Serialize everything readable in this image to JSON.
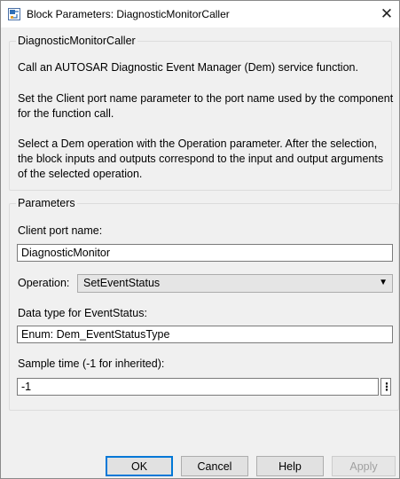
{
  "window": {
    "title": "Block Parameters: DiagnosticMonitorCaller",
    "close_symbol": "✕",
    "app_icon": "simulink-block-icon"
  },
  "description_group": {
    "title": "DiagnosticMonitorCaller",
    "paragraphs": [
      "Call an AUTOSAR Diagnostic Event Manager (Dem) service function.",
      "Set the Client port name parameter to the port name used by the component for the function call.",
      "Select a Dem operation with the Operation parameter.  After the selection, the block inputs and outputs correspond to the input and output arguments of the selected operation."
    ]
  },
  "parameters_group": {
    "title": "Parameters",
    "client_port": {
      "label": "Client port name:",
      "value": "DiagnosticMonitor"
    },
    "operation": {
      "label": "Operation:",
      "value": "SetEventStatus"
    },
    "data_type": {
      "label": "Data type for EventStatus:",
      "value": "Enum: Dem_EventStatusType"
    },
    "sample_time": {
      "label": "Sample time (-1 for inherited):",
      "value": "-1"
    },
    "more_options_symbol": "⋮"
  },
  "buttons": {
    "ok": "OK",
    "cancel": "Cancel",
    "help": "Help",
    "apply": "Apply"
  },
  "colors": {
    "dialog_background": "#f0f0f0",
    "default_button_border": "#0078d7"
  }
}
